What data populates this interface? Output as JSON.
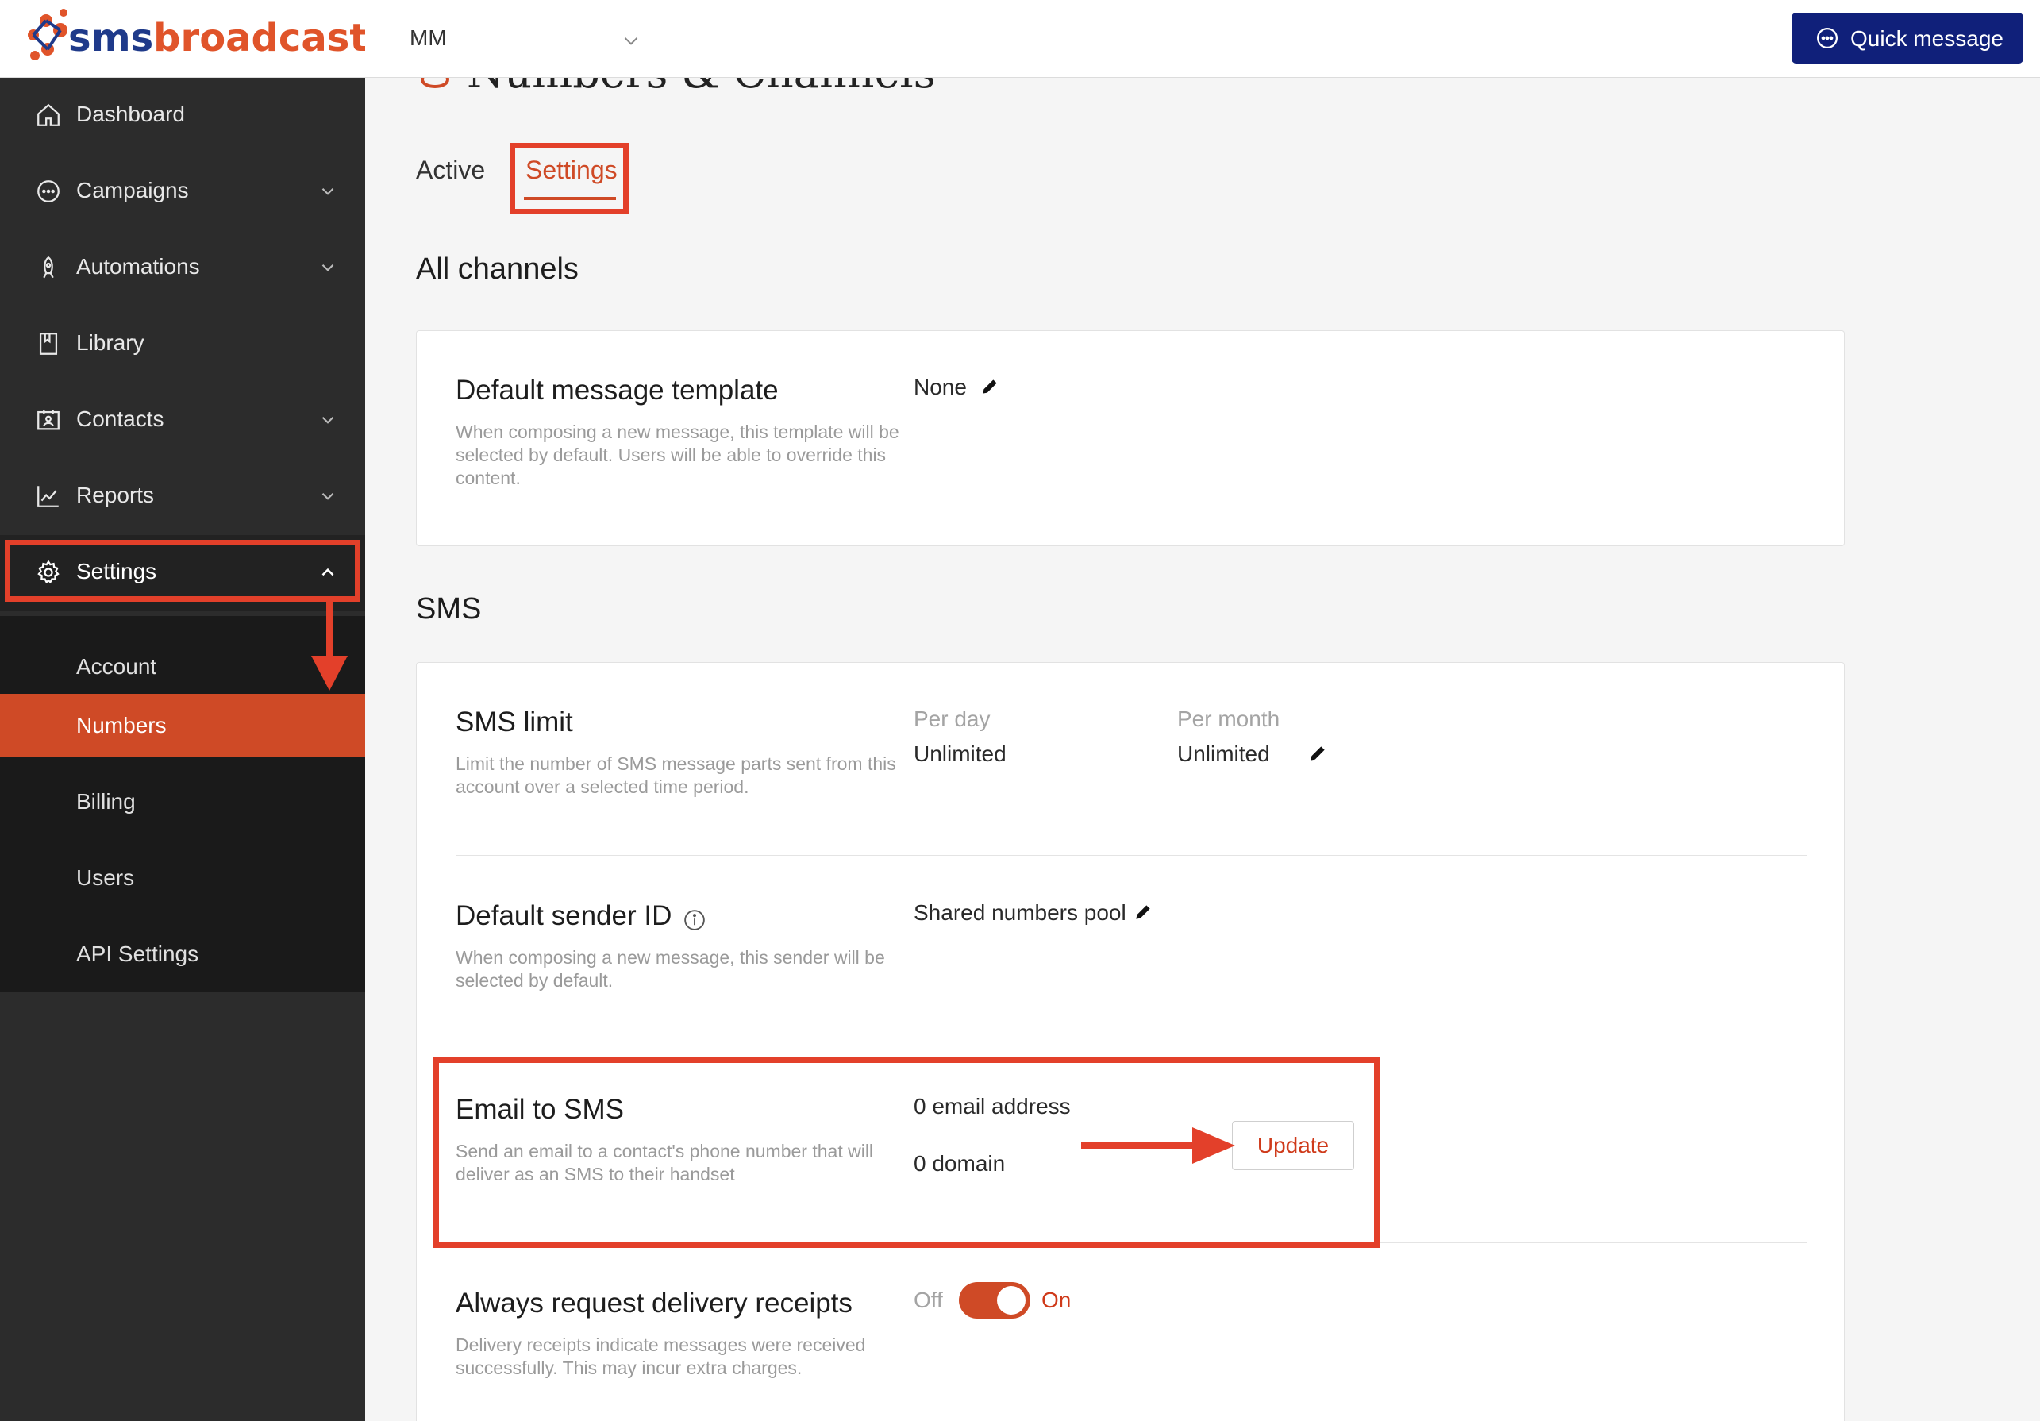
{
  "brand": {
    "logo_sms": "sms",
    "logo_broadcast": "broadcast",
    "accent": "#cf4a26",
    "navy": "#10207a"
  },
  "topbar": {
    "account": "MM",
    "quick_message": "Quick message"
  },
  "header": {
    "title": "Numbers & Channels"
  },
  "sidebar": {
    "items": [
      {
        "label": "Dashboard",
        "icon": "home-icon"
      },
      {
        "label": "Campaigns",
        "icon": "chat-icon"
      },
      {
        "label": "Automations",
        "icon": "rocket-icon"
      },
      {
        "label": "Library",
        "icon": "book-icon"
      },
      {
        "label": "Contacts",
        "icon": "contacts-icon"
      },
      {
        "label": "Reports",
        "icon": "chart-icon"
      },
      {
        "label": "Settings",
        "icon": "gear-icon"
      }
    ],
    "settings_sub": [
      "Account",
      "Numbers",
      "Billing",
      "Users",
      "API Settings"
    ]
  },
  "tabs": {
    "active": "Active",
    "settings": "Settings"
  },
  "all_channels": {
    "title": "All channels",
    "template": {
      "title": "Default message template",
      "desc": "When composing a new message, this template will be selected by default. Users will be able to override this content.",
      "value": "None"
    }
  },
  "sms": {
    "title": "SMS",
    "limit": {
      "title": "SMS limit",
      "desc": "Limit the number of SMS message parts sent from this account over a selected time period.",
      "per_day_label": "Per day",
      "per_day_value": "Unlimited",
      "per_month_label": "Per month",
      "per_month_value": "Unlimited"
    },
    "sender": {
      "title": "Default sender ID",
      "desc": "When composing a new message, this sender will be selected by default.",
      "value": "Shared numbers pool"
    },
    "email_to_sms": {
      "title": "Email to SMS",
      "desc": "Send an email to a contact's phone number that will deliver as an SMS to their handset",
      "email_count": "0 email address",
      "domain_count": "0 domain",
      "update": "Update"
    },
    "receipts": {
      "title": "Always request delivery receipts",
      "desc": "Delivery receipts indicate messages were received successfully. This may incur extra charges.",
      "off": "Off",
      "on": "On",
      "enabled": true
    }
  }
}
